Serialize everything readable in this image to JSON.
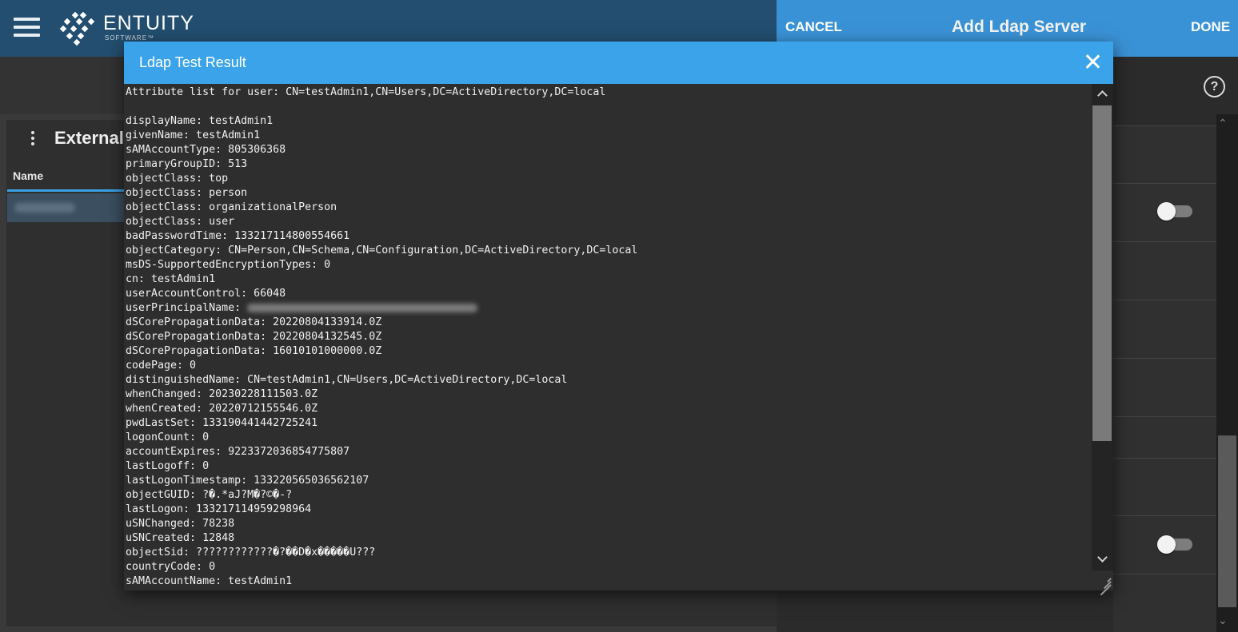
{
  "app": {
    "logo_text": "ENTUITY",
    "logo_sub": "SOFTWARE™"
  },
  "page": {
    "section_title": "External",
    "column_header": "Name"
  },
  "drawer": {
    "cancel_label": "CANCEL",
    "title": "Add Ldap Server",
    "done_label": "DONE",
    "help_glyph": "?"
  },
  "modal": {
    "title": "Ldap Test Result",
    "lines_before_upn": [
      "Attribute list for user: CN=testAdmin1,CN=Users,DC=ActiveDirectory,DC=local",
      "",
      "displayName: testAdmin1",
      "givenName: testAdmin1",
      "sAMAccountType: 805306368",
      "primaryGroupID: 513",
      "objectClass: top",
      "objectClass: person",
      "objectClass: organizationalPerson",
      "objectClass: user",
      "badPasswordTime: 133217114800554661",
      "objectCategory: CN=Person,CN=Schema,CN=Configuration,DC=ActiveDirectory,DC=local",
      "msDS-SupportedEncryptionTypes: 0",
      "cn: testAdmin1",
      "userAccountControl: 66048"
    ],
    "upn_label": "userPrincipalName: ",
    "lines_after_upn": [
      "dSCorePropagationData: 20220804133914.0Z",
      "dSCorePropagationData: 20220804132545.0Z",
      "dSCorePropagationData: 16010101000000.0Z",
      "codePage: 0",
      "distinguishedName: CN=testAdmin1,CN=Users,DC=ActiveDirectory,DC=local",
      "whenChanged: 20230228111503.0Z",
      "whenCreated: 20220712155546.0Z",
      "pwdLastSet: 133190441442725241",
      "logonCount: 0",
      "accountExpires: 9223372036854775807",
      "lastLogoff: 0",
      "lastLogonTimestamp: 133220565036562107",
      "objectGUID: ?�.*aJ?M�?©�-?",
      "lastLogon: 133217114959298964",
      "uSNChanged: 78238",
      "uSNCreated: 12848",
      "objectSid: ????????????�?��D�x�����U???",
      "countryCode: 0",
      "sAMAccountName: testAdmin1"
    ]
  }
}
